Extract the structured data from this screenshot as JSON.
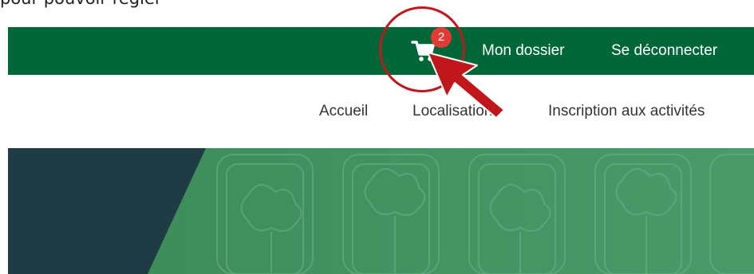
{
  "intro": {
    "text": "pour pouvoir régler"
  },
  "topbar": {
    "cart_icon": "shopping-cart-icon",
    "cart_count": "2",
    "links": [
      {
        "label": "Mon dossier"
      },
      {
        "label": "Se déconnecter"
      }
    ]
  },
  "nav": {
    "items": [
      {
        "label": "Accueil"
      },
      {
        "label": "Localisations"
      },
      {
        "label": "Inscription aux activités"
      }
    ]
  },
  "colors": {
    "topbar": "#006838",
    "badge": "#e53935",
    "hero_dark": "#1f3b44",
    "hero_green": "#3f8f5e",
    "annotation": "#c0161c"
  },
  "annotation": {
    "circle": "highlight-circle",
    "arrow": "pointer-arrow-icon"
  }
}
